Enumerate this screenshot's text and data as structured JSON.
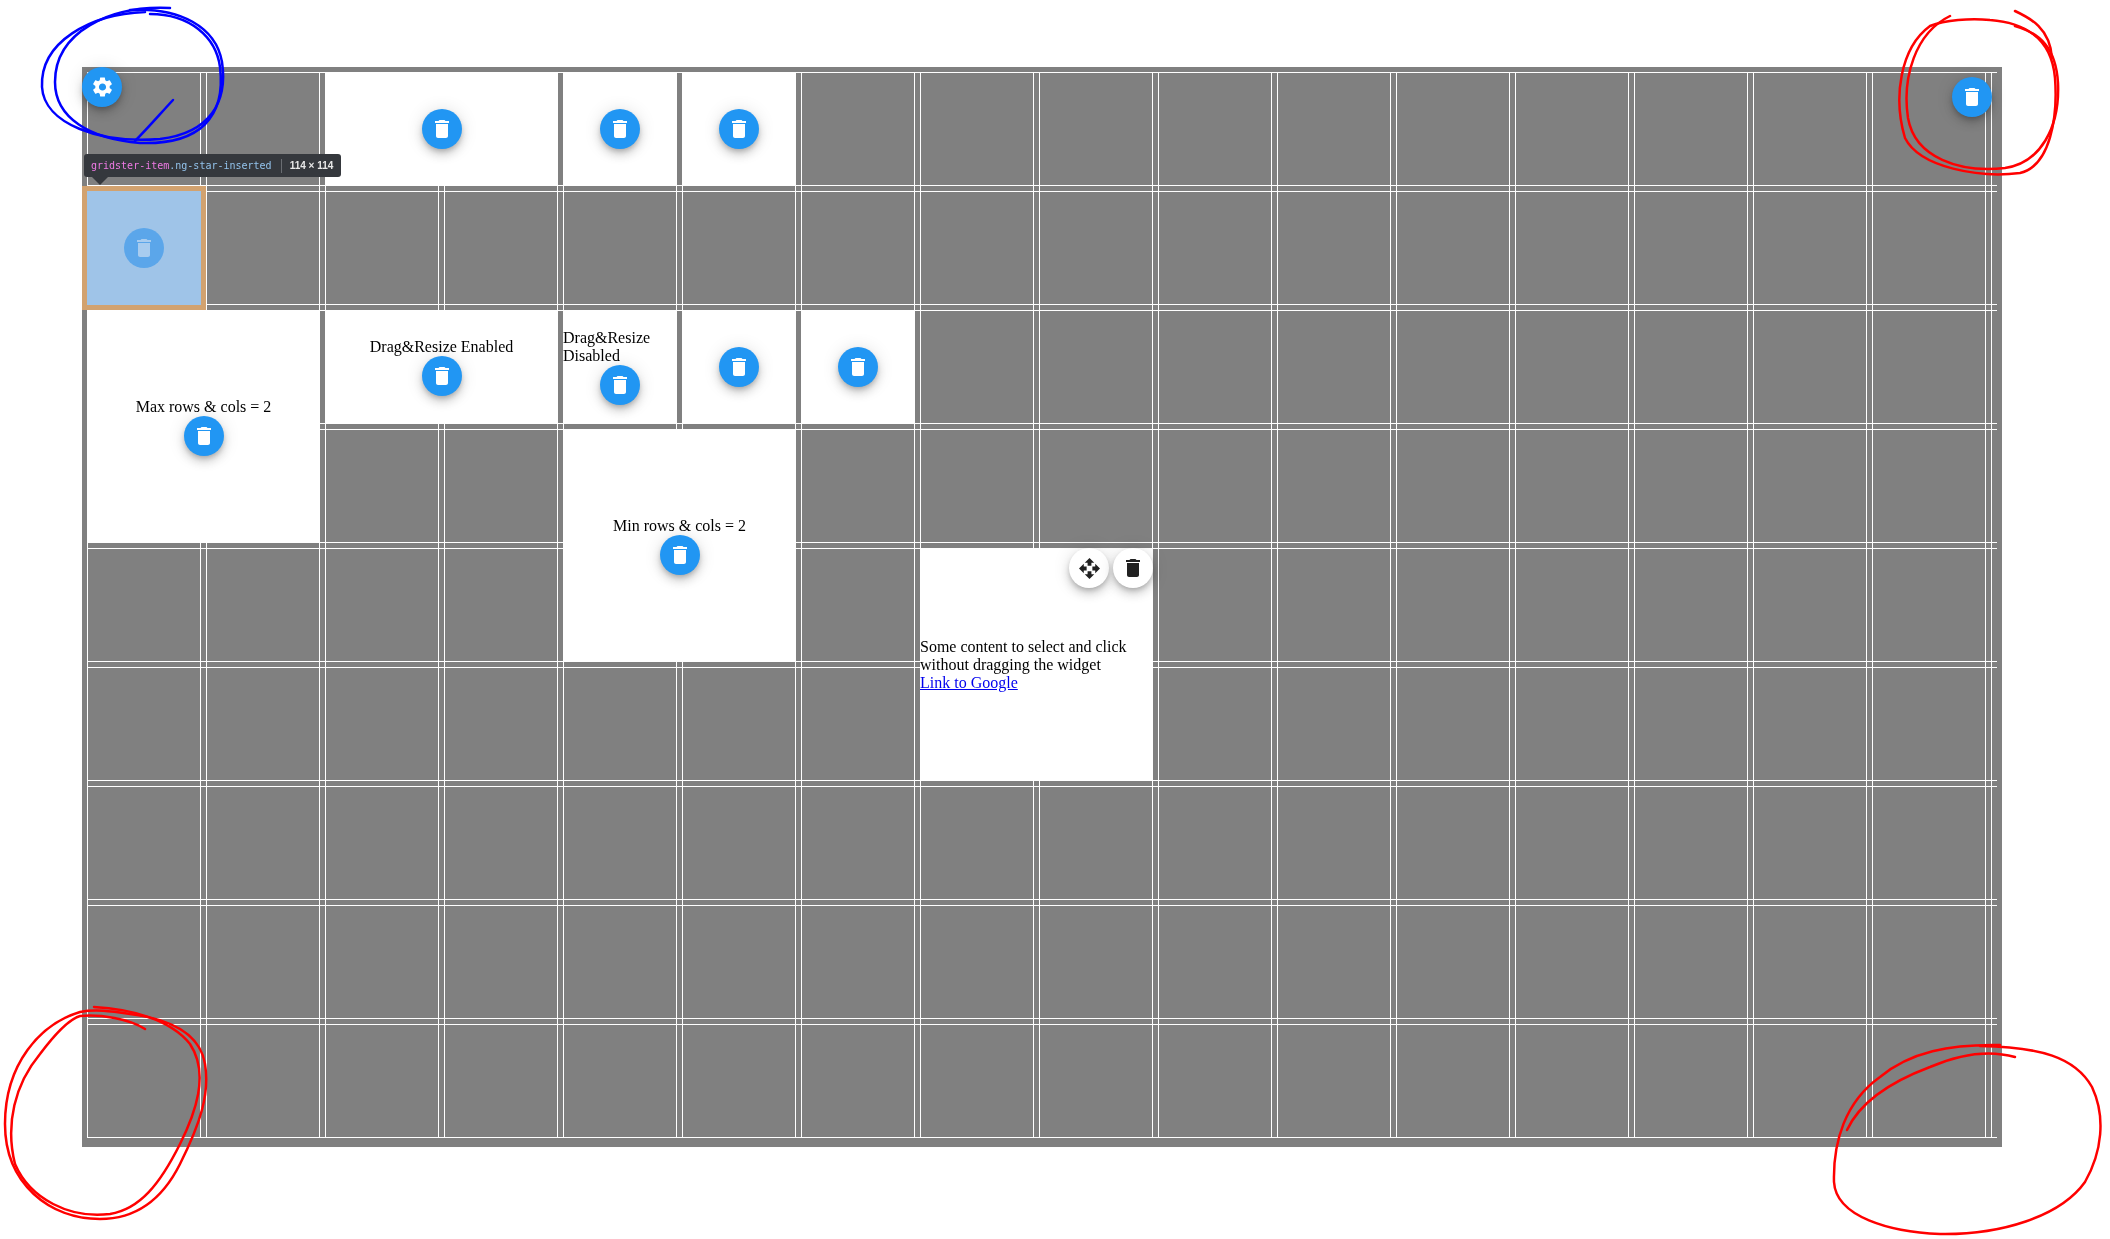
{
  "grid": {
    "items": [
      {
        "kind": "basic",
        "highlighted": false
      },
      {
        "kind": "basic",
        "highlighted": false
      },
      {
        "kind": "basic",
        "highlighted": false
      },
      {
        "kind": "basic",
        "highlighted": true
      },
      {
        "kind": "labeled",
        "highlighted": false,
        "label": "Max rows & cols = 2"
      },
      {
        "kind": "labeled",
        "highlighted": false,
        "label": "Drag&Resize Enabled"
      },
      {
        "kind": "labeled",
        "highlighted": false,
        "label": "Drag&Resize Disabled"
      },
      {
        "kind": "basic",
        "highlighted": false
      },
      {
        "kind": "basic",
        "highlighted": false
      },
      {
        "kind": "labeled",
        "highlighted": false,
        "label": "Min rows & cols = 2"
      },
      {
        "kind": "content",
        "highlighted": false,
        "text": "Some content to select and click without dragging the widget",
        "link": "Link to Google"
      }
    ]
  },
  "inspector_tooltip": {
    "tag": "gridster-item",
    "classes": ".ng-star-inserted",
    "size": "114 × 114"
  },
  "annotations": [
    {
      "color": "#0000ff"
    },
    {
      "color": "#ff0000"
    },
    {
      "color": "#ff0000"
    },
    {
      "color": "#ff0000"
    }
  ]
}
